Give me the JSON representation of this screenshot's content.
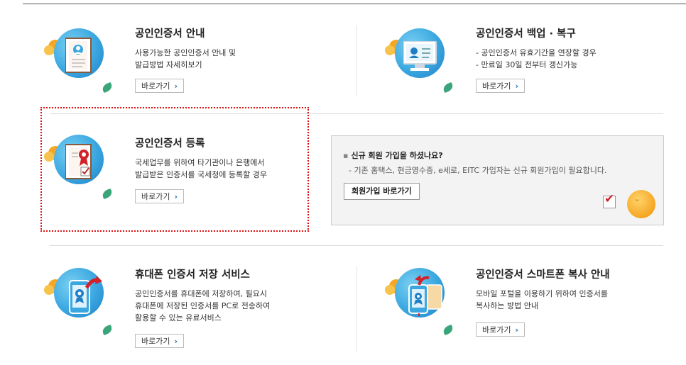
{
  "cards": {
    "guide": {
      "title": "공인인증서 안내",
      "desc1": "사용가능한 공인인증서 안내 및",
      "desc2": "발급방법 자세히보기",
      "button": "바로가기"
    },
    "backup": {
      "title": "공인인증서 백업 · 복구",
      "desc1": "- 공인인증서 유효기간을 연장할 경우",
      "desc2": "- 만료일 30일 전부터 갱신가능",
      "button": "바로가기"
    },
    "register": {
      "title": "공인인증서 등록",
      "desc1": "국세업무를 위하여 타기관이나 은행에서",
      "desc2": "발급받은 인증서를 국세청에 등록할 경우",
      "button": "바로가기"
    },
    "phone": {
      "title": "휴대폰 인증서 저장 서비스",
      "desc1": "공인인증서를 휴대폰에 저장하여, 필요시",
      "desc2": "휴대폰에 저장된 인증서를 PC로 전송하여",
      "desc3": "활용할 수 있는 유료서비스",
      "button": "바로가기"
    },
    "smartphone": {
      "title": "공인인증서 스마트폰 복사 안내",
      "desc1": "모바일 포털을 이용하기 위하여 인증서를",
      "desc2": "복사하는 방법 안내",
      "button": "바로가기"
    }
  },
  "join_panel": {
    "question": "신규 회원 가입을 하셨나요?",
    "detail": "- 기존 홈택스, 현금영수증, e세로, EITC 가입자는 신규 회원가입이 필요합니다.",
    "button": "회원가입 바로가기"
  },
  "colors": {
    "accent": "#1f7fc6",
    "highlight": "#dd1111",
    "leaf": "#3aa57a",
    "orange": "#f5a623"
  },
  "icons": {
    "guide": "certificate-document-icon",
    "backup": "monitor-id-card-icon",
    "register": "certificate-ribbon-icon",
    "phone": "phone-transfer-icon",
    "smartphone": "smartphone-copy-icon"
  }
}
